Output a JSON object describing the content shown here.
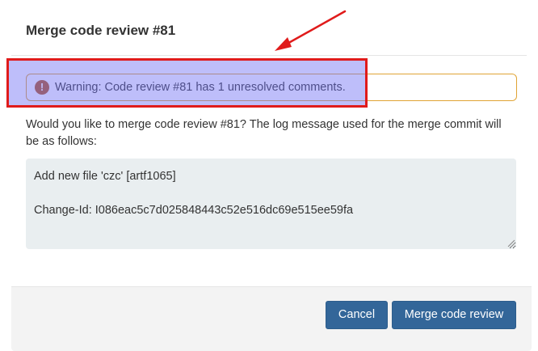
{
  "dialog": {
    "title": "Merge code review #81"
  },
  "alert": {
    "icon": "exclamation-circle-icon",
    "text": "Warning: Code review #81 has 1 unresolved comments.",
    "border_color": "#e0a435",
    "icon_color": "#b5561c"
  },
  "body": {
    "description": "Would you like to merge code review #81? The log message used for the merge commit will be as follows:",
    "commit_message": "Add new file 'czc' [artf1065]\n\nChange-Id: I086eac5c7d025848443c52e516dc69e515ee59fa"
  },
  "footer": {
    "cancel_label": "Cancel",
    "merge_label": "Merge code review"
  },
  "annotation": {
    "highlight_fill": "rgba(110,110,245,0.45)",
    "highlight_border": "#e01b1b",
    "arrow_color": "#e01b1b"
  },
  "colors": {
    "primary_button": "#336699",
    "textarea_bg": "#e9eef0",
    "footer_bg": "#f3f3f3"
  }
}
